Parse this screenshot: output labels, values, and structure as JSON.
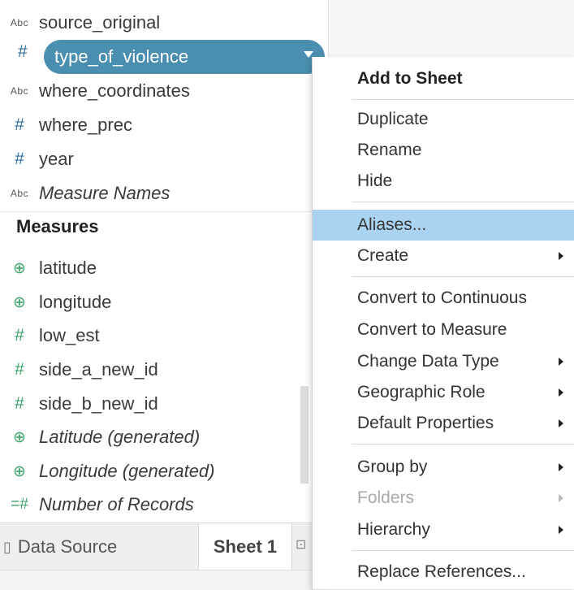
{
  "dimensions": [
    {
      "icon": "abc",
      "label": "source_original",
      "italic": false
    },
    {
      "icon": "hash",
      "label": "type_of_violence",
      "italic": false
    },
    {
      "icon": "abc",
      "label": "where_coordinates",
      "italic": false
    },
    {
      "icon": "hash",
      "label": "where_prec",
      "italic": false
    },
    {
      "icon": "hash",
      "label": "year",
      "italic": false
    },
    {
      "icon": "abc",
      "label": "Measure Names",
      "italic": true
    }
  ],
  "abc_icon_text": "Abc",
  "hash_icon_text": "#",
  "measures_title": "Measures",
  "measures": [
    {
      "icon": "globe",
      "label": "latitude",
      "italic": false
    },
    {
      "icon": "globe",
      "label": "longitude",
      "italic": false
    },
    {
      "icon": "hash",
      "label": "low_est",
      "italic": false
    },
    {
      "icon": "hash",
      "label": "side_a_new_id",
      "italic": false
    },
    {
      "icon": "hash",
      "label": "side_b_new_id",
      "italic": false
    },
    {
      "icon": "globe",
      "label": "Latitude (generated)",
      "italic": true
    },
    {
      "icon": "globe",
      "label": "Longitude (generated)",
      "italic": true
    },
    {
      "icon": "hashcalc",
      "label": "Number of Records",
      "italic": true
    }
  ],
  "tabs": {
    "data_source": "Data Source",
    "sheet": "Sheet 1"
  },
  "menu": {
    "items": [
      {
        "label": "Add to Sheet",
        "bold": true
      },
      {
        "label": "Duplicate"
      },
      {
        "label": "Rename"
      },
      {
        "label": "Hide"
      },
      {
        "label": "Aliases...",
        "highlighted": true
      },
      {
        "label": "Create",
        "submenu": true
      },
      {
        "label": "Convert to Continuous"
      },
      {
        "label": "Convert to Measure"
      },
      {
        "label": "Change Data Type",
        "submenu": true
      },
      {
        "label": "Geographic Role",
        "submenu": true
      },
      {
        "label": "Default Properties",
        "submenu": true
      },
      {
        "label": "Group by",
        "submenu": true
      },
      {
        "label": "Folders",
        "submenu": true,
        "disabled": true
      },
      {
        "label": "Hierarchy",
        "submenu": true
      },
      {
        "label": "Replace References..."
      }
    ]
  },
  "colors": {
    "selected_pill": "#4a8fb0",
    "menu_highlight": "#a9d3f0"
  }
}
